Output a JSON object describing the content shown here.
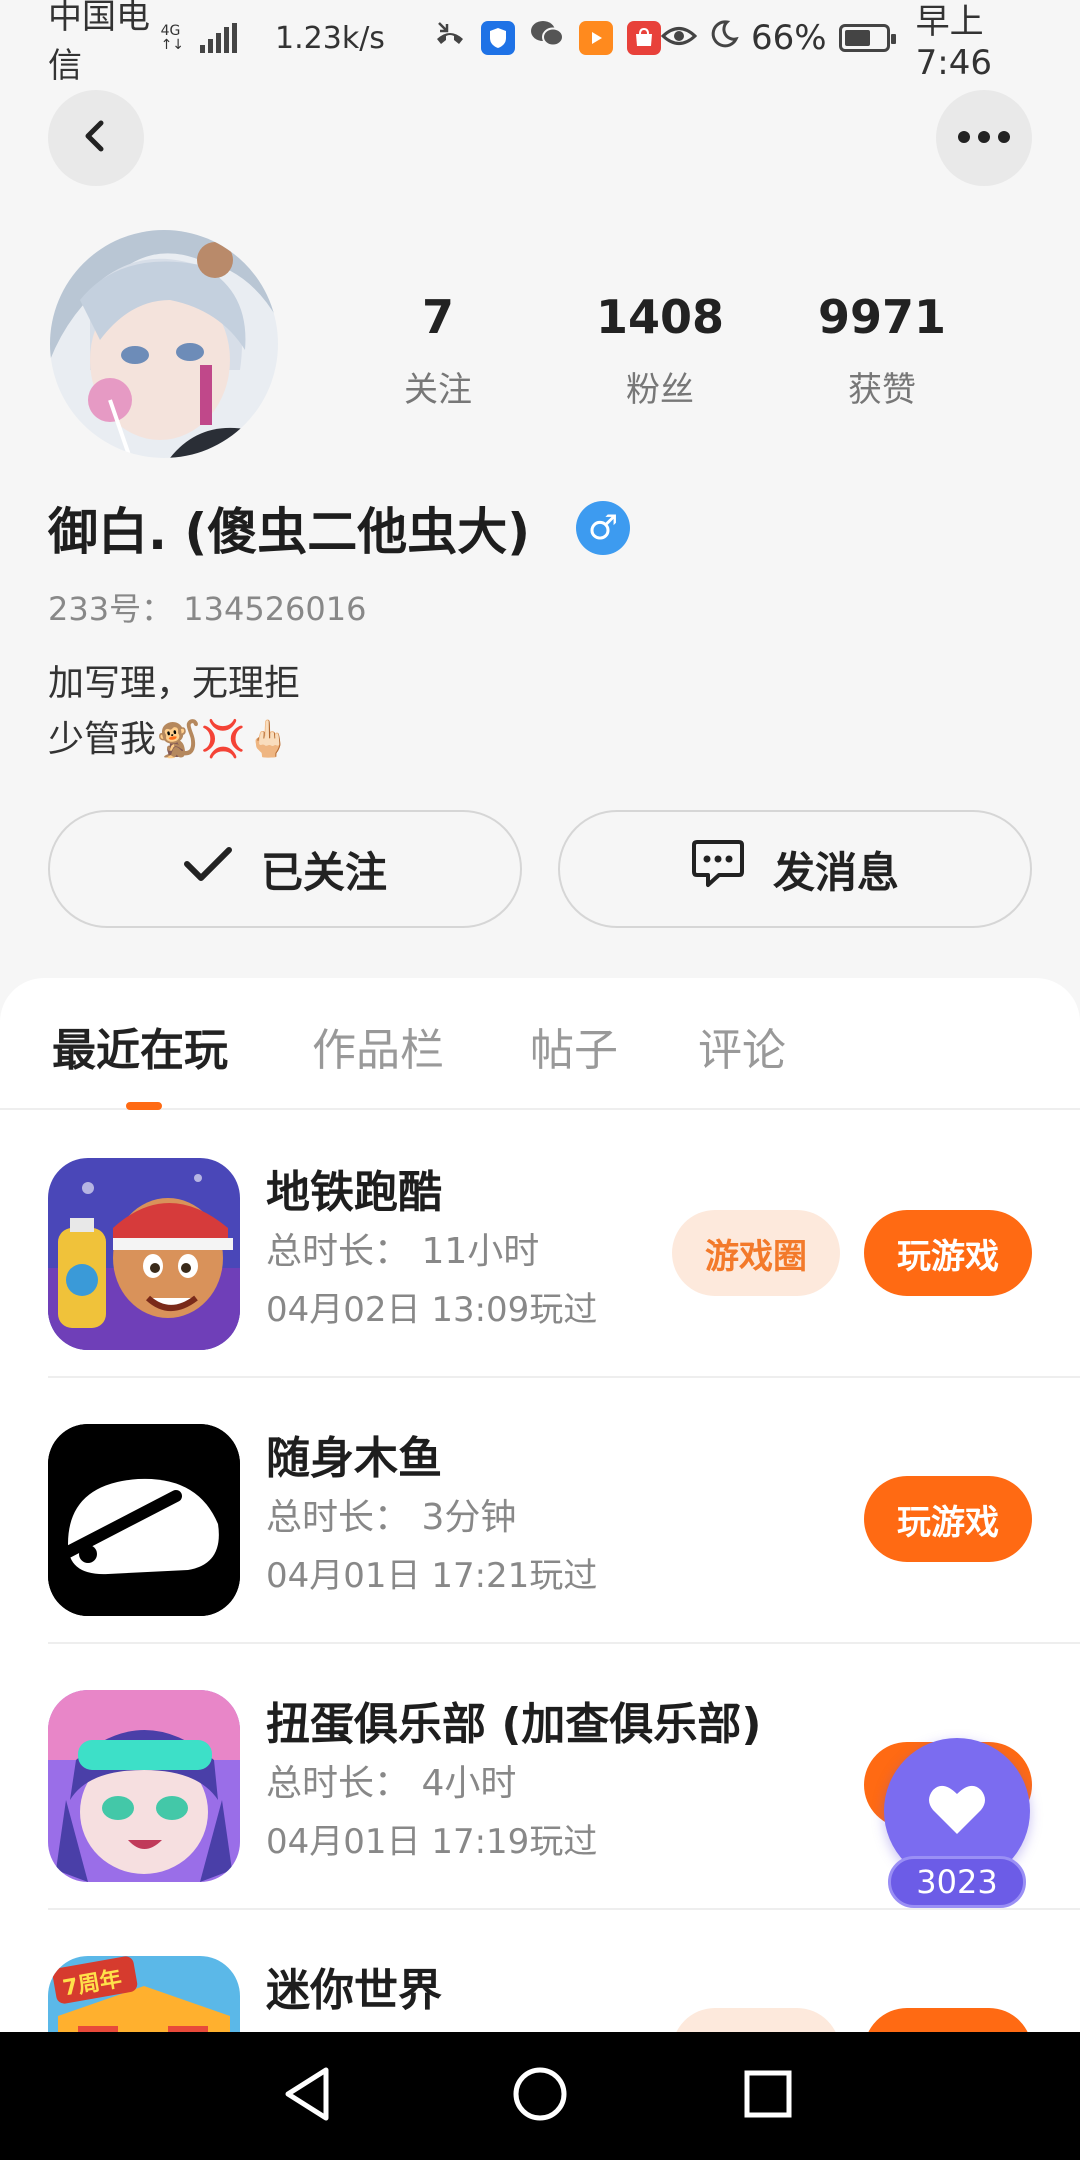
{
  "status_bar": {
    "carrier": "中国电信",
    "network_type": "4G",
    "network_sub": "↑↓",
    "speed": "1.23k/s",
    "battery_percent": "66%",
    "battery_level": 0.66,
    "time": "早上7:46",
    "icons": [
      "missed-call-icon",
      "shield-app-icon",
      "wechat-icon",
      "video-app-icon",
      "huawei-store-icon",
      "eye-icon",
      "moon-icon"
    ]
  },
  "nav": {
    "back_icon": "chevron-left-icon",
    "more_icon": "more-dots-icon"
  },
  "profile": {
    "stats": [
      {
        "num": "7",
        "label": "关注"
      },
      {
        "num": "1408",
        "label": "粉丝"
      },
      {
        "num": "9971",
        "label": "获赞"
      }
    ],
    "username": "御白. (傻虫二他虫大)",
    "gender_symbol": "♂",
    "uid": "233号： 134526016",
    "bio_line1": "加写理，无理拒",
    "bio_line2": "少管我🐒💢🖕🏻"
  },
  "actions": {
    "follow_label": "已关注",
    "message_label": "发消息"
  },
  "tabs": [
    {
      "label": "最近在玩",
      "active": true
    },
    {
      "label": "作品栏",
      "active": false
    },
    {
      "label": "帖子",
      "active": false
    },
    {
      "label": "评论",
      "active": false
    }
  ],
  "games": [
    {
      "name": "地铁跑酷",
      "duration": "总时长： 11小时",
      "last_played": "04月02日 13:09玩过",
      "circle_label": "游戏圈",
      "play_label": "玩游戏"
    },
    {
      "name": "随身木鱼",
      "duration": "总时长： 3分钟",
      "last_played": "04月01日 17:21玩过",
      "play_label": "玩游戏"
    },
    {
      "name": "扭蛋俱乐部 (加查俱乐部)",
      "duration": "总时长： 4小时",
      "last_played": "04月01日 17:19玩过",
      "play_label": "玩游戏"
    },
    {
      "name": "迷你世界",
      "icon_badge": "7周年"
    }
  ],
  "floating_like": {
    "count": "3023"
  },
  "colors": {
    "accent": "#ff6a13",
    "accent_light": "#fde9dc",
    "gender_blue": "#3d9bf0",
    "like_purple": "#7b6cf0"
  }
}
